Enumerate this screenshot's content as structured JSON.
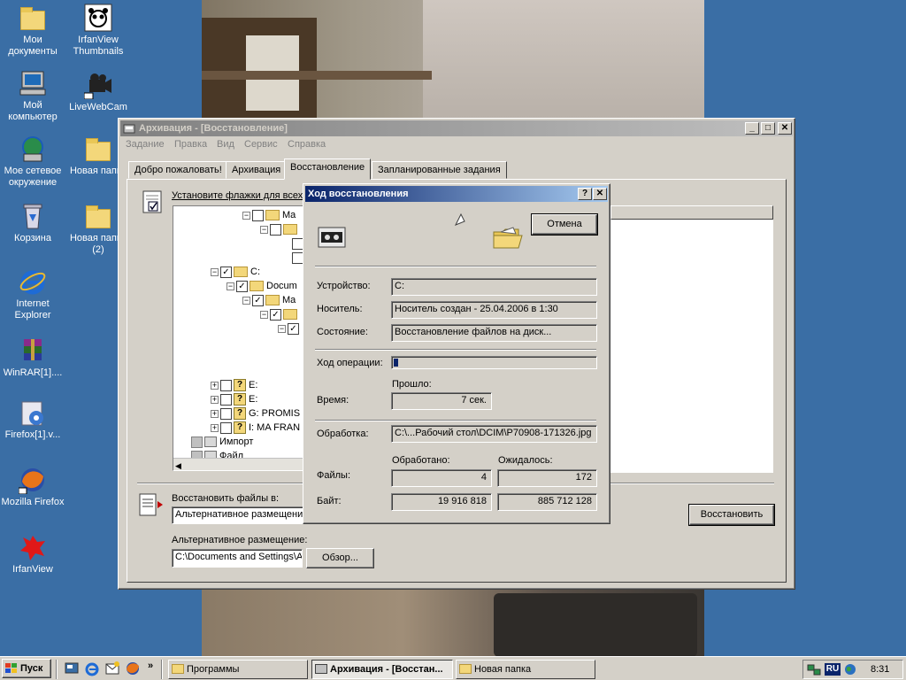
{
  "desktop": {
    "icons": [
      {
        "label": "Мои документы",
        "icon": "my-documents-icon"
      },
      {
        "label": "IrfanView Thumbnails",
        "icon": "irfanview-thumbnails-icon"
      },
      {
        "label": "Мой компьютер",
        "icon": "my-computer-icon"
      },
      {
        "label": "LiveWebCam",
        "icon": "webcam-icon"
      },
      {
        "label": "Мое сетевое окружение",
        "icon": "network-icon"
      },
      {
        "label": "Новая папка",
        "icon": "folder-icon"
      },
      {
        "label": "Корзина",
        "icon": "recycle-bin-icon"
      },
      {
        "label": "Новая папка (2)",
        "icon": "folder-icon"
      },
      {
        "label": "Internet Explorer",
        "icon": "ie-icon"
      },
      {
        "label": "WinRAR[1]....",
        "icon": "winrar-icon"
      },
      {
        "label": "Firefox[1].v...",
        "icon": "installer-icon"
      },
      {
        "label": "Mozilla Firefox",
        "icon": "firefox-icon"
      },
      {
        "label": "IrfanView",
        "icon": "irfanview-icon"
      }
    ]
  },
  "main_window": {
    "title": "Архивация - [Восстановление]",
    "menu": [
      "Задание",
      "Правка",
      "Вид",
      "Сервис",
      "Справка"
    ],
    "tabs": [
      "Добро пожаловать!",
      "Архивация",
      "Восстановление",
      "Запланированные задания"
    ],
    "selected_tab": "Восстановление",
    "instruction": "Установите флажки для всех",
    "tree": [
      {
        "text": "Ma"
      },
      {
        "text": ""
      },
      {
        "text": ""
      },
      {
        "text": ""
      },
      {
        "text": "C:"
      },
      {
        "text": "Docum"
      },
      {
        "text": "Ma"
      },
      {
        "text": ""
      },
      {
        "text": ""
      },
      {
        "text": "E:"
      },
      {
        "text": "E:"
      },
      {
        "text": "G: PROMIS"
      },
      {
        "text": "I: MA FRAN"
      },
      {
        "text": "Импорт"
      },
      {
        "text": "Файл"
      }
    ],
    "restore_to_label": "Восстановить файлы в:",
    "restore_to_value": "Альтернативное размещени",
    "alt_location_label": "Альтернативное размещение:",
    "alt_location_value": "C:\\Documents and Settings\\A",
    "browse_button": "Обзор...",
    "restore_button": "Восстановить"
  },
  "progress_dialog": {
    "title": "Ход восстановления",
    "cancel_button": "Отмена",
    "device_label": "Устройство:",
    "device_value": "C:",
    "media_label": "Носитель:",
    "media_value": "Носитель создан - 25.04.2006 в 1:30",
    "state_label": "Состояние:",
    "state_value": "Восстановление файлов на диск...",
    "progress_label": "Ход операции:",
    "progress_fraction": 0.02,
    "elapsed_header": "Прошло:",
    "time_label": "Время:",
    "time_value": "7 сек.",
    "processing_label": "Обработка:",
    "processing_value": "C:\\...Рабочий стол\\DCIM\\P70908-171326.jpg",
    "processed_header": "Обработано:",
    "expected_header": "Ожидалось:",
    "files_label": "Файлы:",
    "files_processed": "4",
    "files_expected": "172",
    "bytes_label": "Байт:",
    "bytes_processed": "19 916 818",
    "bytes_expected": "885 712 128"
  },
  "taskbar": {
    "start_label": "Пуск",
    "chevron": "»",
    "tasks": [
      {
        "label": "Программы",
        "active": false
      },
      {
        "label": "Архивация - [Восстан...",
        "active": true
      },
      {
        "label": "Новая папка",
        "active": false
      }
    ],
    "lang": "RU",
    "clock": "8:31"
  }
}
